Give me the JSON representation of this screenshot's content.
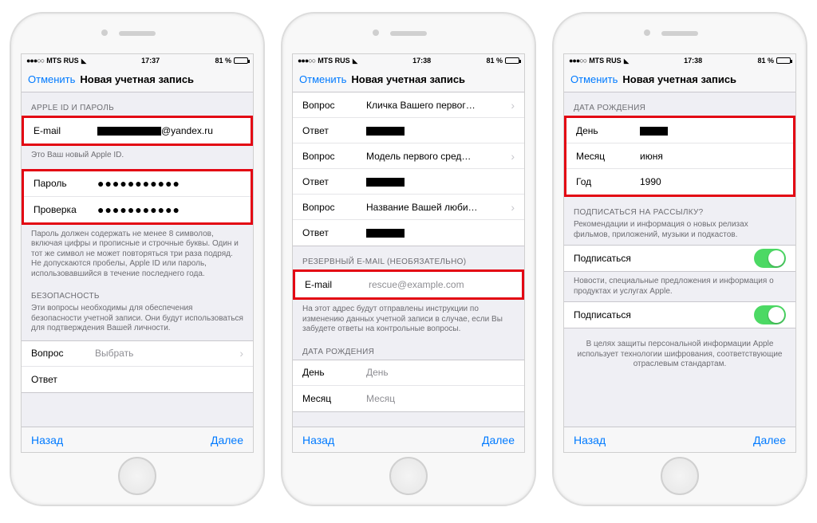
{
  "status": {
    "carrier": "MTS RUS",
    "batteryPct": "81 %"
  },
  "times": [
    "17:37",
    "17:38",
    "17:38"
  ],
  "nav": {
    "cancel": "Отменить",
    "title": "Новая учетная запись"
  },
  "toolbar": {
    "back": "Назад",
    "next": "Далее"
  },
  "p1": {
    "section1": "APPLE ID И ПАРОЛЬ",
    "emailLabel": "E-mail",
    "emailDomain": "@yandex.ru",
    "emailFoot": "Это Ваш новый Apple ID.",
    "pwLabel": "Пароль",
    "pwVerifyLabel": "Проверка",
    "pwDots": "●●●●●●●●●●●",
    "pwFoot": "Пароль должен содержать не менее 8 символов, включая цифры и прописные и строчные буквы. Один и тот же символ не может повторяться три раза подряд. Не допускаются пробелы, Apple ID или пароль, использовавшийся в течение последнего года.",
    "section2": "БЕЗОПАСНОСТЬ",
    "secFoot": "Эти вопросы необходимы для обеспечения безопасности учетной записи. Они будут использоваться для подтверждения Вашей личности.",
    "qLabel": "Вопрос",
    "qPlaceholder": "Выбрать",
    "aLabel": "Ответ"
  },
  "p2": {
    "qLabel": "Вопрос",
    "aLabel": "Ответ",
    "q1": "Кличка Вашего первог…",
    "q2": "Модель первого сред…",
    "q3": "Название Вашей люби…",
    "sectionRescue": "РЕЗЕРВНЫЙ E-MAIL (НЕОБЯЗАТЕЛЬНО)",
    "emailLabel": "E-mail",
    "rescuePlaceholder": "rescue@example.com",
    "rescueFoot": "На этот адрес будут отправлены инструкции по изменению данных учетной записи в случае, если Вы забудете ответы на контрольные вопросы.",
    "sectionDOB": "ДАТА РОЖДЕНИЯ",
    "dayLabel": "День",
    "dayPH": "День",
    "monthLabel": "Месяц",
    "monthPH": "Месяц"
  },
  "p3": {
    "sectionDOB": "ДАТА РОЖДЕНИЯ",
    "dayLabel": "День",
    "monthLabel": "Месяц",
    "monthVal": "июня",
    "yearLabel": "Год",
    "yearVal": "1990",
    "sectionSub": "ПОДПИСАТЬСЯ НА РАССЫЛКУ?",
    "subFoot1": "Рекомендации и информация о новых релизах фильмов, приложений, музыки и подкастов.",
    "subscribe": "Подписаться",
    "subFoot2": "Новости, специальные предложения и информация о продуктах и услугах Apple.",
    "privacy": "В целях защиты персональной информации Apple использует технологии шифрования, соответствующие отраслевым стандартам."
  }
}
